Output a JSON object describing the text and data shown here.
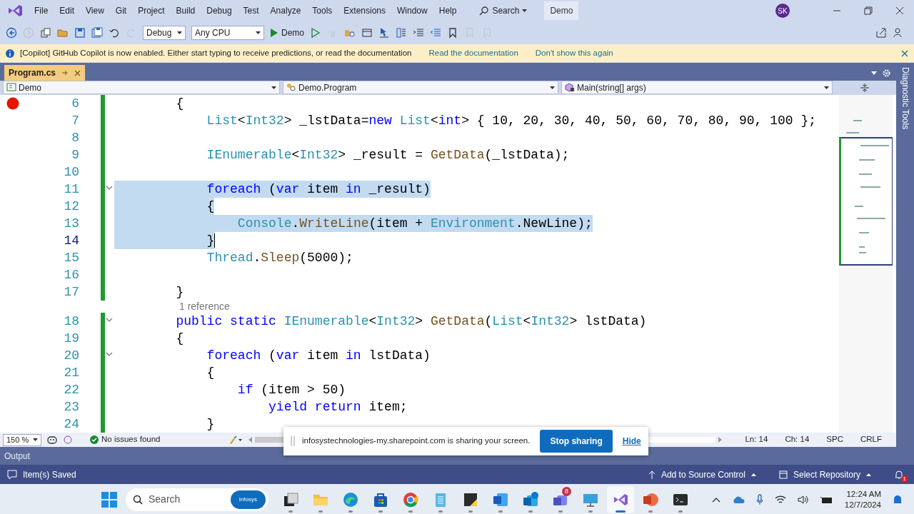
{
  "title_bar": {
    "menu": [
      "File",
      "Edit",
      "View",
      "Git",
      "Project",
      "Build",
      "Debug",
      "Test",
      "Analyze",
      "Tools",
      "Extensions",
      "Window",
      "Help"
    ],
    "search": "Search",
    "solution": "Demo",
    "avatar": "SK"
  },
  "toolbar": {
    "configuration": "Debug",
    "platform": "Any CPU",
    "start": "Demo"
  },
  "info_bar": {
    "message": "[Copilot] GitHub Copilot is now enabled. Either start typing to receive predictions, or read the documentation",
    "links": [
      "Read the documentation",
      "Don't show this again"
    ]
  },
  "tabs": [
    {
      "label": "Program.cs",
      "selected": true
    }
  ],
  "navigation": [
    "Demo",
    "Demo.Program",
    "Main(string[] args)"
  ],
  "side_tab": "Diagnostic Tools",
  "editor": {
    "saved_changes": true,
    "lines": [
      {
        "num": "6",
        "breakpoint": true,
        "tokens": [
          {
            "kind": "plain",
            "text": "        {"
          }
        ]
      },
      {
        "num": "7",
        "tokens": [
          {
            "kind": "type",
            "text": "            List"
          },
          {
            "kind": "plain",
            "text": "<"
          },
          {
            "kind": "type",
            "text": "Int32"
          },
          {
            "kind": "plain",
            "text": "> _lstData="
          },
          {
            "kind": "keyword",
            "text": "new"
          },
          {
            "kind": "type",
            "text": " List"
          },
          {
            "kind": "plain",
            "text": "<"
          },
          {
            "kind": "keyword",
            "text": "int"
          },
          {
            "kind": "plain",
            "text": "> { 10, 20, 30, 40, 50, 60, 70, 80, 90, 100 };"
          }
        ]
      },
      {
        "num": "8"
      },
      {
        "num": "9",
        "tokens": [
          {
            "kind": "type",
            "text": "            IEnumerable"
          },
          {
            "kind": "plain",
            "text": "<"
          },
          {
            "kind": "type",
            "text": "Int32"
          },
          {
            "kind": "plain",
            "text": "> _result = "
          },
          {
            "kind": "method",
            "text": "GetData"
          },
          {
            "kind": "plain",
            "text": "(_lstData);"
          }
        ]
      },
      {
        "num": "10"
      },
      {
        "num": "11",
        "fold": true,
        "selected": true,
        "tokens": [
          {
            "kind": "keyword",
            "text": "            foreach"
          },
          {
            "kind": "plain",
            "text": " ("
          },
          {
            "kind": "keyword",
            "text": "var"
          },
          {
            "kind": "plain",
            "text": " item "
          },
          {
            "kind": "keyword",
            "text": "in"
          },
          {
            "kind": "plain",
            "text": " _result)"
          }
        ]
      },
      {
        "num": "12",
        "selected": true,
        "tokens": [
          {
            "kind": "plain",
            "text": "            {"
          }
        ]
      },
      {
        "num": "13",
        "selected": true,
        "tokens": [
          {
            "kind": "type",
            "text": "                Console"
          },
          {
            "kind": "plain",
            "text": "."
          },
          {
            "kind": "method",
            "text": "WriteLine"
          },
          {
            "kind": "plain",
            "text": "(item + "
          },
          {
            "kind": "type",
            "text": "Environment"
          },
          {
            "kind": "plain",
            "text": ".NewLine);"
          }
        ]
      },
      {
        "num": "14",
        "selected": true,
        "current": true,
        "tokens": [
          {
            "kind": "plain",
            "text": "            }"
          }
        ]
      },
      {
        "num": "15",
        "tokens": [
          {
            "kind": "type",
            "text": "            Thread"
          },
          {
            "kind": "plain",
            "text": "."
          },
          {
            "kind": "method",
            "text": "Sleep"
          },
          {
            "kind": "plain",
            "text": "(5000);"
          }
        ]
      },
      {
        "num": "16"
      },
      {
        "num": "17",
        "tokens": [
          {
            "kind": "plain",
            "text": "        }"
          }
        ]
      },
      {
        "num": "18",
        "fold": true,
        "codelens": "1 reference",
        "tokens": [
          {
            "kind": "keyword",
            "text": "        public"
          },
          {
            "kind": "keyword",
            "text": " static"
          },
          {
            "kind": "type",
            "text": " IEnumerable"
          },
          {
            "kind": "plain",
            "text": "<"
          },
          {
            "kind": "type",
            "text": "Int32"
          },
          {
            "kind": "plain",
            "text": "> "
          },
          {
            "kind": "method",
            "text": "GetData"
          },
          {
            "kind": "plain",
            "text": "("
          },
          {
            "kind": "type",
            "text": "List"
          },
          {
            "kind": "plain",
            "text": "<"
          },
          {
            "kind": "type",
            "text": "Int32"
          },
          {
            "kind": "plain",
            "text": "> lstData)"
          }
        ]
      },
      {
        "num": "19",
        "tokens": [
          {
            "kind": "plain",
            "text": "        {"
          }
        ]
      },
      {
        "num": "20",
        "fold": true,
        "tokens": [
          {
            "kind": "keyword",
            "text": "            foreach"
          },
          {
            "kind": "plain",
            "text": " ("
          },
          {
            "kind": "keyword",
            "text": "var"
          },
          {
            "kind": "plain",
            "text": " item "
          },
          {
            "kind": "keyword",
            "text": "in"
          },
          {
            "kind": "plain",
            "text": " lstData)"
          }
        ]
      },
      {
        "num": "21",
        "tokens": [
          {
            "kind": "plain",
            "text": "            {"
          }
        ]
      },
      {
        "num": "22",
        "tokens": [
          {
            "kind": "keyword",
            "text": "                if"
          },
          {
            "kind": "plain",
            "text": " (item > 50)"
          }
        ]
      },
      {
        "num": "23",
        "tokens": [
          {
            "kind": "keyword",
            "text": "                    yield"
          },
          {
            "kind": "keyword",
            "text": " return"
          },
          {
            "kind": "plain",
            "text": " item;"
          }
        ]
      },
      {
        "num": "24",
        "tokens": [
          {
            "kind": "plain",
            "text": "            }"
          }
        ]
      }
    ]
  },
  "editor_status": {
    "zoom": "150 %",
    "issues": "No issues found",
    "line": "Ln: 14",
    "column": "Ch: 14",
    "whitespace": "SPC",
    "line_ending": "CRLF"
  },
  "share_banner": {
    "message": "infosystechnologies-my.sharepoint.com is sharing your screen.",
    "button": "Stop sharing",
    "link": "Hide"
  },
  "output_tab": "Output",
  "status_bar": {
    "message": "Item(s) Saved",
    "source_control": "Add to Source Control",
    "repository": "Select Repository",
    "notifications": "1"
  },
  "taskbar": {
    "search": "Search",
    "search_badge": "Infosys",
    "apps": [
      {
        "kind": "taskview",
        "active": false
      },
      {
        "kind": "folder",
        "active": false
      },
      {
        "kind": "edge",
        "active": false
      },
      {
        "kind": "store",
        "active": false
      },
      {
        "kind": "chrome",
        "active": false
      },
      {
        "kind": "notepad",
        "active": false
      },
      {
        "kind": "sticky",
        "active": false
      },
      {
        "kind": "word",
        "active": false
      },
      {
        "kind": "outlook",
        "active": false
      },
      {
        "kind": "teams",
        "active": false,
        "badge": "8"
      },
      {
        "kind": "monitor",
        "active": false
      },
      {
        "kind": "vs",
        "active": true
      },
      {
        "kind": "powerpoint",
        "active": false
      },
      {
        "kind": "terminal",
        "active": false
      }
    ],
    "time": "12:24 AM",
    "date": "12/7/2024"
  }
}
